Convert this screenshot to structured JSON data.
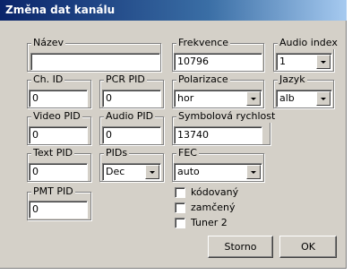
{
  "window": {
    "title": "Změna dat kanálu"
  },
  "fields": {
    "nazev": {
      "label": "Název",
      "value": ""
    },
    "frekvence": {
      "label": "Frekvence",
      "value": "10796"
    },
    "audio_index": {
      "label": "Audio index",
      "value": "1"
    },
    "ch_id": {
      "label": "Ch. ID",
      "value": "0"
    },
    "pcr_pid": {
      "label": "PCR PID",
      "value": "0"
    },
    "polarizace": {
      "label": "Polarizace",
      "value": "hor"
    },
    "jazyk": {
      "label": "Jazyk",
      "value": "alb"
    },
    "video_pid": {
      "label": "Video PID",
      "value": "0"
    },
    "audio_pid": {
      "label": "Audio PID",
      "value": "0"
    },
    "symbolova_rychlost": {
      "label": "Symbolová rychlost",
      "value": "13740"
    },
    "text_pid": {
      "label": "Text PID",
      "value": "0"
    },
    "pids": {
      "label": "PIDs",
      "value": "Dec"
    },
    "fec": {
      "label": "FEC",
      "value": "auto"
    },
    "pmt_pid": {
      "label": "PMT PID",
      "value": "0"
    }
  },
  "checkboxes": [
    {
      "label": "kódovaný",
      "checked": false
    },
    {
      "label": "zamčený",
      "checked": false
    },
    {
      "label": "Tuner 2",
      "checked": false
    }
  ],
  "buttons": {
    "storno": "Storno",
    "ok": "OK"
  }
}
